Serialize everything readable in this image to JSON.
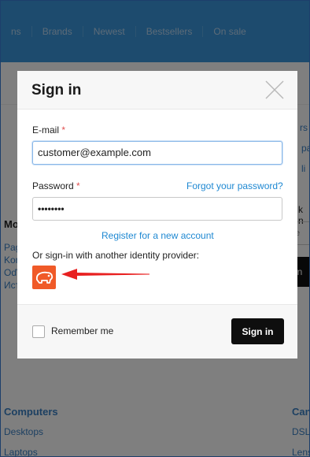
{
  "background": {
    "nav": [
      "ns",
      "Brands",
      "Newest",
      "Bestsellers",
      "On sale"
    ],
    "left_fragments": [
      "Mo",
      "Pag",
      "Kor",
      "Oď",
      "Ист"
    ],
    "right_fragments": [
      "rs",
      "pa",
      "li",
      "k n",
      "te",
      "gn"
    ],
    "footer_left": [
      "Computers",
      "Desktops",
      "Laptops"
    ],
    "footer_right": [
      "Can",
      "DSL",
      "Lens"
    ]
  },
  "modal": {
    "title": "Sign in",
    "email_label": "E-mail",
    "email_value": "customer@example.com",
    "password_label": "Password",
    "password_value": "••••••••",
    "required_mark": "*",
    "forgot_link": "Forgot your password?",
    "register_link": "Register for a new account",
    "provider_text": "Or sign-in with another identity provider:",
    "remember_label": "Remember me",
    "signin_button": "Sign in"
  },
  "colors": {
    "nav_bg": "#3a97dc",
    "link": "#1e88d2",
    "provider": "#f05a28",
    "arrow": "#e82020",
    "button": "#0e0e0e"
  },
  "icons": {
    "close": "close-icon",
    "provider": "bear-icon",
    "arrow": "red-arrow-icon"
  }
}
